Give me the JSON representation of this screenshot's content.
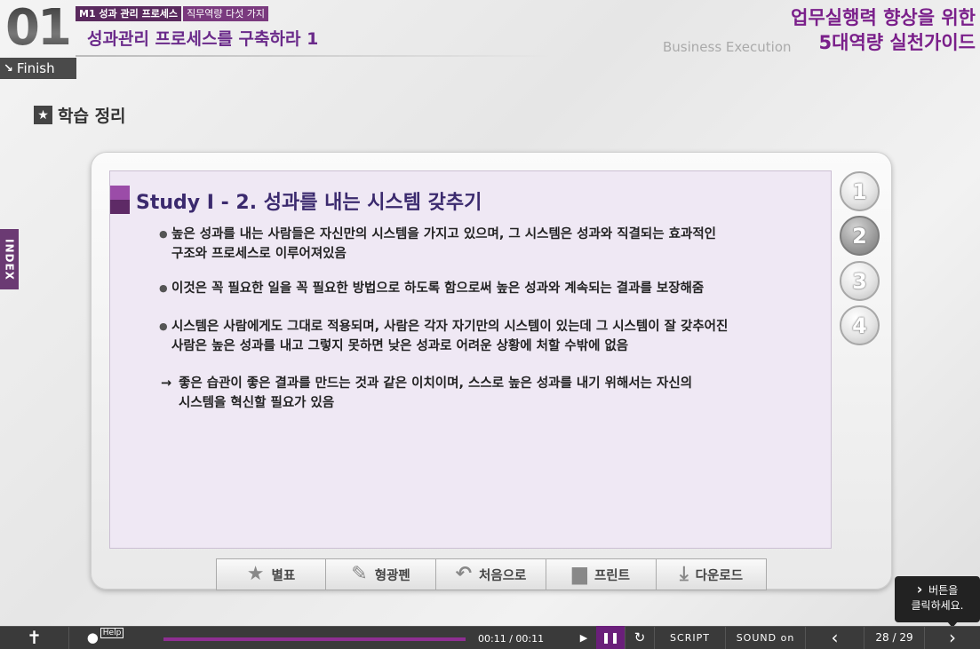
{
  "header": {
    "module_number": "01",
    "module_code": "M1 성과 관리 프로세스",
    "module_sub": "직무역량 다섯 가지",
    "module_title": "성과관리 프로세스를 구축하라 1",
    "finish_label": "Finish",
    "course_title_line1": "업무실행력 향상을 위한",
    "course_title_line2": "5대역량 실천가이드",
    "course_en": "Business Execution"
  },
  "section": {
    "heading": "학습 정리",
    "index_label": "INDEX"
  },
  "content": {
    "study_title": "Study  I - 2. 성과를 내는 시스템 갖추기",
    "bullets": [
      "높은 성과를 내는 사람들은 자신만의 시스템을 가지고 있으며, 그 시스템은 성과와 직결되는 효과적인\n구조와 프로세스로 이루어져있음",
      "이것은 꼭 필요한 일을 꼭 필요한 방법으로 하도록 함으로써 높은 성과와 계속되는 결과를 보장해줌",
      "시스템은 사람에게도 그대로 적용되며, 사람은 각자 자기만의 시스템이 있는데 그 시스템이 잘 갖추어진\n사람은 높은 성과를 내고 그렇지 못하면 낮은 성과로 어려운 상황에 처할 수밖에 없음"
    ],
    "conclusion_arrow": "→",
    "conclusion": "좋은 습관이 좋은 결과를 만드는 것과 같은 이치이며, 스스로 높은 성과를 내기 위해서는 자신의\n시스템을 혁신할 필요가 있음"
  },
  "pages": [
    "1",
    "2",
    "3",
    "4"
  ],
  "active_page": 2,
  "toolbar": {
    "bookmark": "별표",
    "highlighter": "형광펜",
    "first": "처음으로",
    "print": "프린트",
    "download": "다운로드"
  },
  "tooltip": {
    "line1": "버튼을",
    "line2": "클릭하세요."
  },
  "controls": {
    "help_label": "Help",
    "time": "00:11 / 00:11",
    "script_label": "SCRIPT",
    "sound_label": "SOUND on",
    "page_indicator": "28 / 29"
  },
  "colors": {
    "accent_purple": "#7a1f8a",
    "panel_bg": "#efe8f4",
    "control_bar": "#3a3a3a",
    "progress": "#8e2e92"
  }
}
